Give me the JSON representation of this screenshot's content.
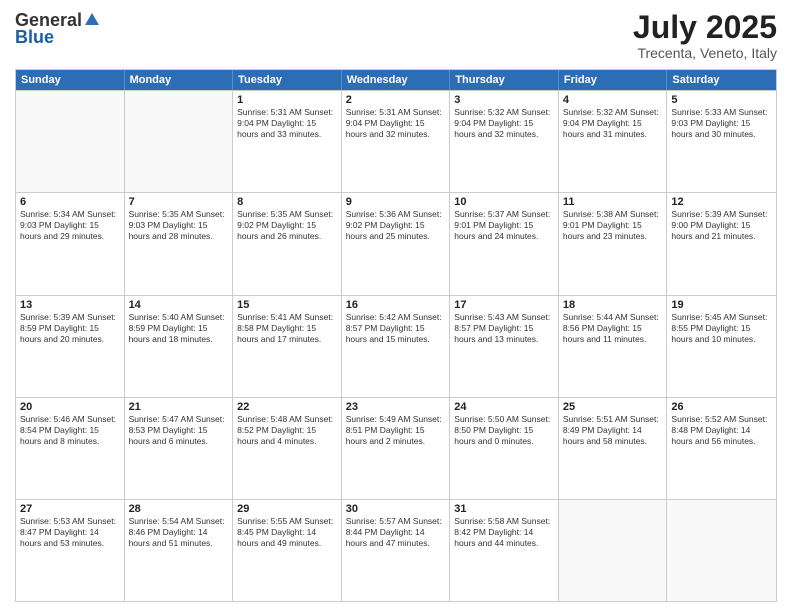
{
  "header": {
    "logo_general": "General",
    "logo_blue": "Blue",
    "month": "July 2025",
    "location": "Trecenta, Veneto, Italy"
  },
  "days_of_week": [
    "Sunday",
    "Monday",
    "Tuesday",
    "Wednesday",
    "Thursday",
    "Friday",
    "Saturday"
  ],
  "rows": [
    [
      {
        "day": "",
        "text": ""
      },
      {
        "day": "",
        "text": ""
      },
      {
        "day": "1",
        "text": "Sunrise: 5:31 AM\nSunset: 9:04 PM\nDaylight: 15 hours\nand 33 minutes."
      },
      {
        "day": "2",
        "text": "Sunrise: 5:31 AM\nSunset: 9:04 PM\nDaylight: 15 hours\nand 32 minutes."
      },
      {
        "day": "3",
        "text": "Sunrise: 5:32 AM\nSunset: 9:04 PM\nDaylight: 15 hours\nand 32 minutes."
      },
      {
        "day": "4",
        "text": "Sunrise: 5:32 AM\nSunset: 9:04 PM\nDaylight: 15 hours\nand 31 minutes."
      },
      {
        "day": "5",
        "text": "Sunrise: 5:33 AM\nSunset: 9:03 PM\nDaylight: 15 hours\nand 30 minutes."
      }
    ],
    [
      {
        "day": "6",
        "text": "Sunrise: 5:34 AM\nSunset: 9:03 PM\nDaylight: 15 hours\nand 29 minutes."
      },
      {
        "day": "7",
        "text": "Sunrise: 5:35 AM\nSunset: 9:03 PM\nDaylight: 15 hours\nand 28 minutes."
      },
      {
        "day": "8",
        "text": "Sunrise: 5:35 AM\nSunset: 9:02 PM\nDaylight: 15 hours\nand 26 minutes."
      },
      {
        "day": "9",
        "text": "Sunrise: 5:36 AM\nSunset: 9:02 PM\nDaylight: 15 hours\nand 25 minutes."
      },
      {
        "day": "10",
        "text": "Sunrise: 5:37 AM\nSunset: 9:01 PM\nDaylight: 15 hours\nand 24 minutes."
      },
      {
        "day": "11",
        "text": "Sunrise: 5:38 AM\nSunset: 9:01 PM\nDaylight: 15 hours\nand 23 minutes."
      },
      {
        "day": "12",
        "text": "Sunrise: 5:39 AM\nSunset: 9:00 PM\nDaylight: 15 hours\nand 21 minutes."
      }
    ],
    [
      {
        "day": "13",
        "text": "Sunrise: 5:39 AM\nSunset: 8:59 PM\nDaylight: 15 hours\nand 20 minutes."
      },
      {
        "day": "14",
        "text": "Sunrise: 5:40 AM\nSunset: 8:59 PM\nDaylight: 15 hours\nand 18 minutes."
      },
      {
        "day": "15",
        "text": "Sunrise: 5:41 AM\nSunset: 8:58 PM\nDaylight: 15 hours\nand 17 minutes."
      },
      {
        "day": "16",
        "text": "Sunrise: 5:42 AM\nSunset: 8:57 PM\nDaylight: 15 hours\nand 15 minutes."
      },
      {
        "day": "17",
        "text": "Sunrise: 5:43 AM\nSunset: 8:57 PM\nDaylight: 15 hours\nand 13 minutes."
      },
      {
        "day": "18",
        "text": "Sunrise: 5:44 AM\nSunset: 8:56 PM\nDaylight: 15 hours\nand 11 minutes."
      },
      {
        "day": "19",
        "text": "Sunrise: 5:45 AM\nSunset: 8:55 PM\nDaylight: 15 hours\nand 10 minutes."
      }
    ],
    [
      {
        "day": "20",
        "text": "Sunrise: 5:46 AM\nSunset: 8:54 PM\nDaylight: 15 hours\nand 8 minutes."
      },
      {
        "day": "21",
        "text": "Sunrise: 5:47 AM\nSunset: 8:53 PM\nDaylight: 15 hours\nand 6 minutes."
      },
      {
        "day": "22",
        "text": "Sunrise: 5:48 AM\nSunset: 8:52 PM\nDaylight: 15 hours\nand 4 minutes."
      },
      {
        "day": "23",
        "text": "Sunrise: 5:49 AM\nSunset: 8:51 PM\nDaylight: 15 hours\nand 2 minutes."
      },
      {
        "day": "24",
        "text": "Sunrise: 5:50 AM\nSunset: 8:50 PM\nDaylight: 15 hours\nand 0 minutes."
      },
      {
        "day": "25",
        "text": "Sunrise: 5:51 AM\nSunset: 8:49 PM\nDaylight: 14 hours\nand 58 minutes."
      },
      {
        "day": "26",
        "text": "Sunrise: 5:52 AM\nSunset: 8:48 PM\nDaylight: 14 hours\nand 56 minutes."
      }
    ],
    [
      {
        "day": "27",
        "text": "Sunrise: 5:53 AM\nSunset: 8:47 PM\nDaylight: 14 hours\nand 53 minutes."
      },
      {
        "day": "28",
        "text": "Sunrise: 5:54 AM\nSunset: 8:46 PM\nDaylight: 14 hours\nand 51 minutes."
      },
      {
        "day": "29",
        "text": "Sunrise: 5:55 AM\nSunset: 8:45 PM\nDaylight: 14 hours\nand 49 minutes."
      },
      {
        "day": "30",
        "text": "Sunrise: 5:57 AM\nSunset: 8:44 PM\nDaylight: 14 hours\nand 47 minutes."
      },
      {
        "day": "31",
        "text": "Sunrise: 5:58 AM\nSunset: 8:42 PM\nDaylight: 14 hours\nand 44 minutes."
      },
      {
        "day": "",
        "text": ""
      },
      {
        "day": "",
        "text": ""
      }
    ]
  ]
}
